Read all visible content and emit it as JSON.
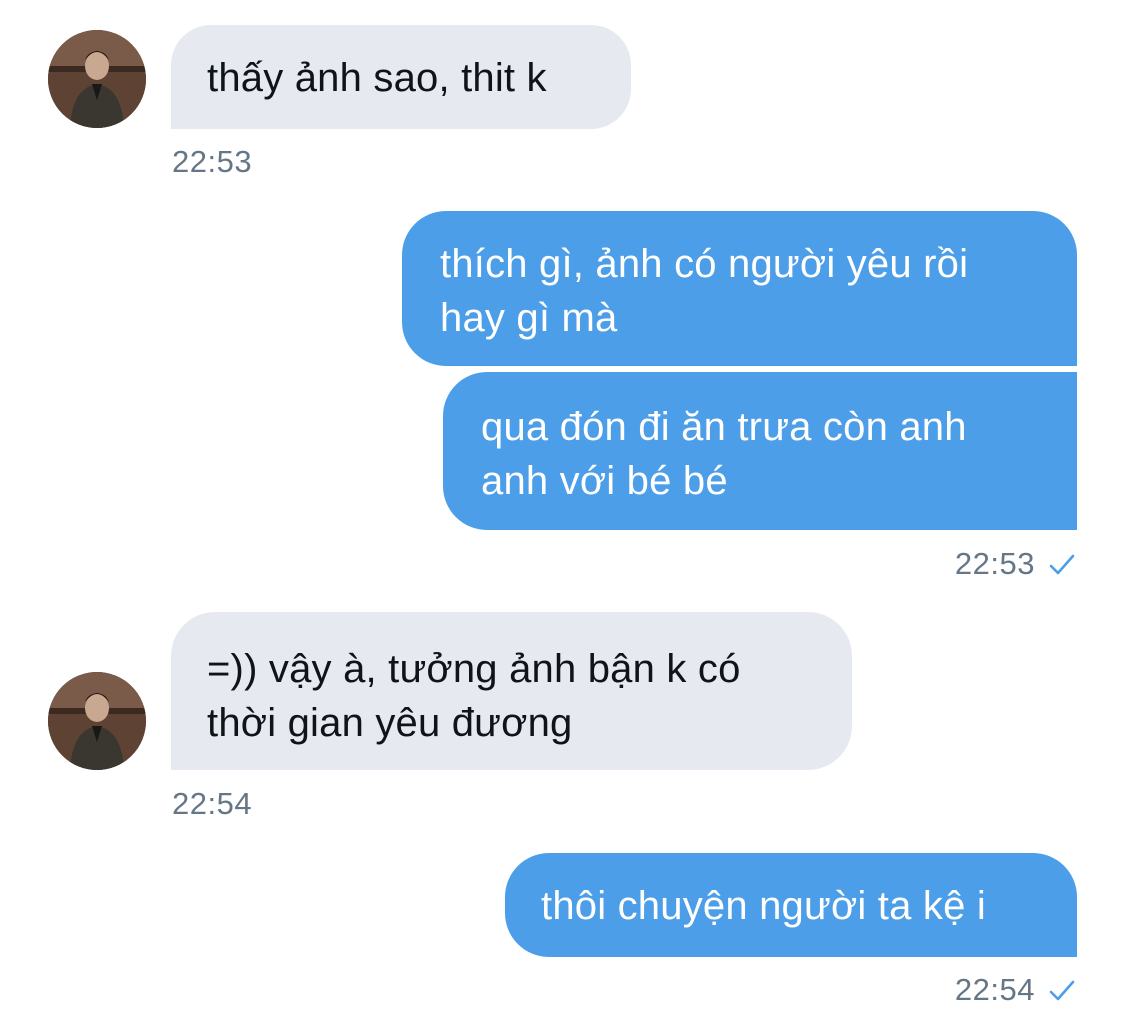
{
  "colors": {
    "incoming_bubble": "#e6e9ef",
    "outgoing_bubble": "#4c9ee8",
    "timestamp": "#657786",
    "read_check": "#4c9ee8"
  },
  "messages": [
    {
      "direction": "incoming",
      "text": "thấy ảnh sao, thit k"
    },
    {
      "direction": "outgoing",
      "text": "thích gì, ảnh có người yêu rồi\nhay gì mà"
    },
    {
      "direction": "outgoing",
      "text": "qua đón đi ăn trưa còn anh\nanh với bé bé"
    },
    {
      "direction": "incoming",
      "text": "=)) vậy à, tưởng ảnh bận k có\nthời gian yêu đương"
    },
    {
      "direction": "outgoing",
      "text": "thôi chuyện người ta kệ i"
    }
  ],
  "timestamps": {
    "t1": "22:53",
    "t2": "22:53",
    "t3": "22:54",
    "t4": "22:54"
  },
  "icons": {
    "avatar": "user-avatar-photo",
    "read_receipt": "checkmark-icon"
  }
}
